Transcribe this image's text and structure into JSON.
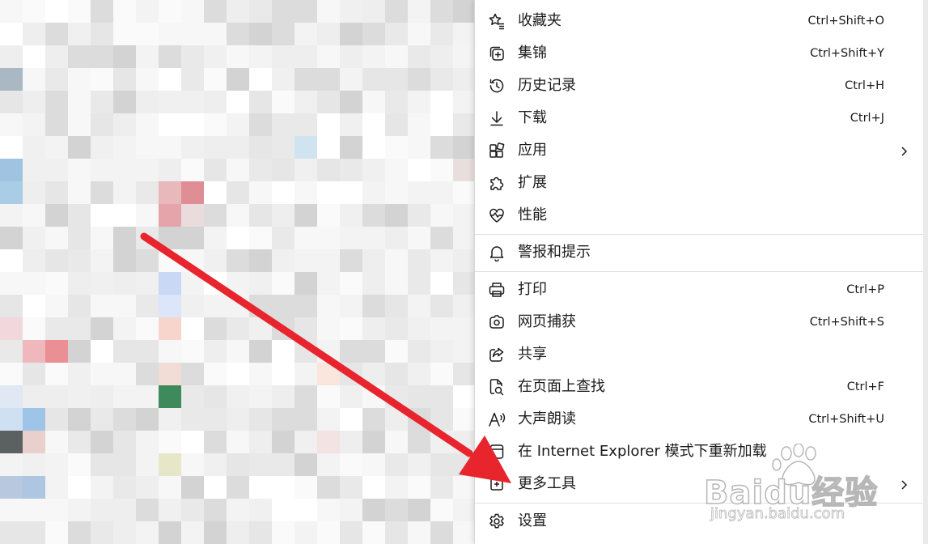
{
  "menu": {
    "items": [
      {
        "id": "favorites",
        "label": "收藏夹",
        "shortcut": "Ctrl+Shift+O",
        "icon": "star-list-icon"
      },
      {
        "id": "collections",
        "label": "集锦",
        "shortcut": "Ctrl+Shift+Y",
        "icon": "collections-icon"
      },
      {
        "id": "history",
        "label": "历史记录",
        "shortcut": "Ctrl+H",
        "icon": "history-icon"
      },
      {
        "id": "downloads",
        "label": "下载",
        "shortcut": "Ctrl+J",
        "icon": "download-icon"
      },
      {
        "id": "apps",
        "label": "应用",
        "shortcut": "",
        "icon": "apps-icon",
        "submenu": true
      },
      {
        "id": "extensions",
        "label": "扩展",
        "shortcut": "",
        "icon": "puzzle-icon"
      },
      {
        "id": "performance",
        "label": "性能",
        "shortcut": "",
        "icon": "heartbeat-icon"
      },
      {
        "id": "alerts",
        "label": "警报和提示",
        "shortcut": "",
        "icon": "bell-icon"
      },
      {
        "id": "print",
        "label": "打印",
        "shortcut": "Ctrl+P",
        "icon": "printer-icon"
      },
      {
        "id": "web-capture",
        "label": "网页捕获",
        "shortcut": "Ctrl+Shift+S",
        "icon": "web-capture-icon"
      },
      {
        "id": "share",
        "label": "共享",
        "shortcut": "",
        "icon": "share-icon"
      },
      {
        "id": "find",
        "label": "在页面上查找",
        "shortcut": "Ctrl+F",
        "icon": "find-on-page-icon"
      },
      {
        "id": "read-aloud",
        "label": "大声朗读",
        "shortcut": "Ctrl+Shift+U",
        "icon": "read-aloud-icon"
      },
      {
        "id": "ie-mode",
        "label": "在 Internet Explorer 模式下重新加载",
        "shortcut": "",
        "icon": "ie-mode-icon"
      },
      {
        "id": "more-tools",
        "label": "更多工具",
        "shortcut": "",
        "icon": "more-tools-icon",
        "submenu": true
      },
      {
        "id": "settings",
        "label": "设置",
        "shortcut": "",
        "icon": "gear-icon"
      }
    ]
  },
  "watermark": {
    "brand": "Baidu经验",
    "url": "jingyan.baidu.com"
  },
  "annotation": {
    "arrow_color": "#e8242c"
  }
}
